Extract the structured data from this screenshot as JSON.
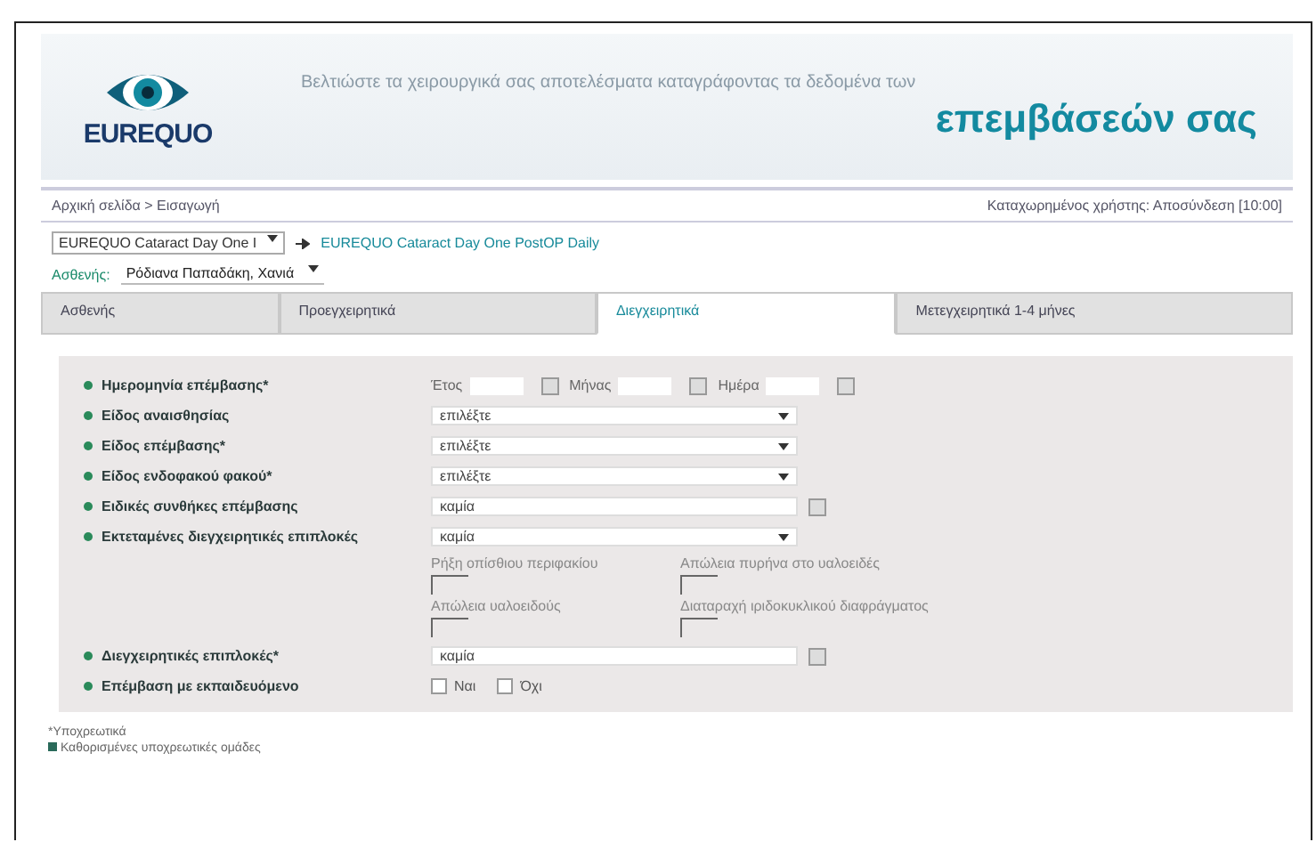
{
  "header": {
    "logo": "EUREQUO",
    "tagline": "Βελτιώστε τα χειρουργικά σας αποτελέσματα καταγράφοντας τα δεδομένα των",
    "headline": "επεμβάσεών σας"
  },
  "breadcrumb": "Αρχική σελίδα > Εισαγωγή",
  "user_info": "Καταχωρημένος χρήστης: Αποσύνδεση [10:00]",
  "study": {
    "selector": "EUREQUO Cataract Day One I",
    "link": "EUREQUO Cataract Day One PostOP Daily"
  },
  "patient": {
    "label": "Ασθενής:",
    "value": "Ρόδιανα Παπαδάκη, Χανιά"
  },
  "tabs": [
    {
      "label": "Ασθενής",
      "selected": false
    },
    {
      "label": "Προεγχειρητικά",
      "selected": false
    },
    {
      "label": "Διεγχειρητικά",
      "selected": true
    },
    {
      "label": "Μετεγχειρητικά 1-4 μήνες",
      "selected": false
    }
  ],
  "fields": [
    {
      "kind": "date",
      "label": "Ημερομηνία επέμβασης*",
      "parts": [
        "Έτος",
        "Μήνας",
        "Ημέρα"
      ]
    },
    {
      "kind": "select",
      "label": "Είδος αναισθησίας",
      "value": "επιλέξτε"
    },
    {
      "kind": "select",
      "label": "Είδος επέμβασης*",
      "value": "επιλέξτε"
    },
    {
      "kind": "select",
      "label": "Είδος ενδοφακού φακού*",
      "value": "επιλέξτε"
    },
    {
      "kind": "text",
      "label": "Ειδικές συνθήκες επέμβασης",
      "value": "καμία"
    },
    {
      "kind": "select",
      "label": "Εκτεταμένες διεγχειρητικές επιπλοκές",
      "value": "καμία",
      "subfields": [
        "Ρήξη οπίσθιου περιφακίου",
        "Απώλεια πυρήνα στο υαλοειδές",
        "Απώλεια υαλοειδούς",
        "Διαταραχή ιριδοκυκλικού διαφράγματος"
      ]
    },
    {
      "kind": "text",
      "label": "Διεγχειρητικές επιπλοκές*",
      "value": "καμία"
    },
    {
      "kind": "checks",
      "label": "Επέμβαση με εκπαιδευόμενο",
      "options": [
        {
          "label": "Ναι",
          "checked": false
        },
        {
          "label": "Όχι",
          "checked": false
        }
      ]
    }
  ],
  "footer": [
    "*Υποχρεωτικά",
    "Καθορισμένες υποχρεωτικές ομάδες"
  ]
}
